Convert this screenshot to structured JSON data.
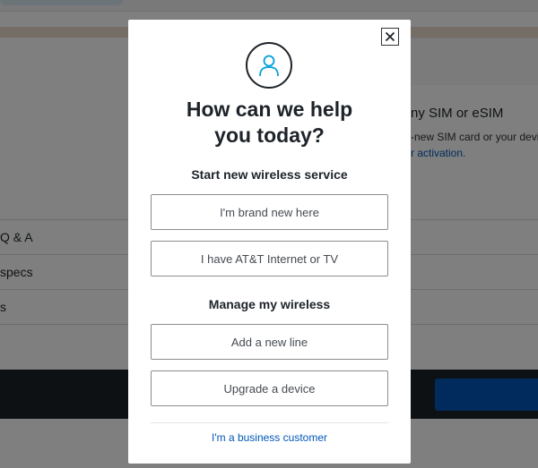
{
  "background": {
    "sim_title": "ny SIM or eSIM",
    "sim_text": "-new SIM card or your devic",
    "sim_link": "r activation.",
    "rows": [
      "Q & A",
      "specs",
      "s"
    ]
  },
  "modal": {
    "title_line1": "How can we help",
    "title_line2": "you today?",
    "section_new": "Start new wireless service",
    "btn_brand_new": "I'm brand new here",
    "btn_att_internet": "I have AT&T Internet or TV",
    "section_manage": "Manage my wireless",
    "btn_add_line": "Add a new line",
    "btn_upgrade": "Upgrade a device",
    "business_link": "I'm a business customer",
    "close_icon": "close-icon",
    "avatar_icon": "person-icon"
  },
  "colors": {
    "text_dark": "#1d2329",
    "link_blue": "#0057b8",
    "avatar_accent": "#009fdb",
    "overlay": "rgba(0,0,0,0.5)"
  }
}
